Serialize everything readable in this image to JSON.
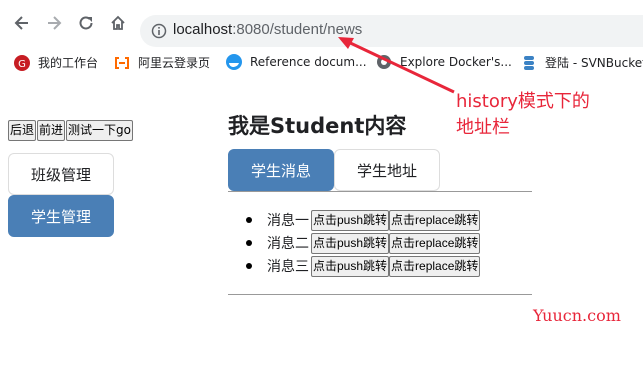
{
  "browser": {
    "url_host": "localhost",
    "url_rest": ":8080/student/news"
  },
  "bookmarks": [
    {
      "label": "我的工作台",
      "icon": "gitee-icon",
      "color": "#c71d23"
    },
    {
      "label": "阿里云登录页",
      "icon": "aliyun-icon",
      "color": "#ff6a00"
    },
    {
      "label": "Reference docum...",
      "icon": "docker-icon",
      "color": "#2496ed"
    },
    {
      "label": "Explore Docker's...",
      "icon": "globe-icon",
      "color": "#5f6368"
    },
    {
      "label": "登陆 - SVNBucket",
      "icon": "database-icon",
      "color": "#3b82c4"
    }
  ],
  "page": {
    "buttons": [
      "后退",
      "前进",
      "测试一下go"
    ],
    "sidebar": [
      "班级管理",
      "学生管理"
    ],
    "title": "我是Student内容",
    "tabs": [
      "学生消息",
      "学生地址"
    ],
    "messages": [
      "消息一",
      "消息二",
      "消息三"
    ],
    "push_label": "点击push跳转",
    "replace_label": "点击replace跳转"
  },
  "annotation": {
    "text_line1": "history模式下的",
    "text_line2": "地址栏",
    "color": "#e8263a"
  },
  "watermark": "Yuucn.com",
  "colors": {
    "accent": "#4a7fb6"
  }
}
